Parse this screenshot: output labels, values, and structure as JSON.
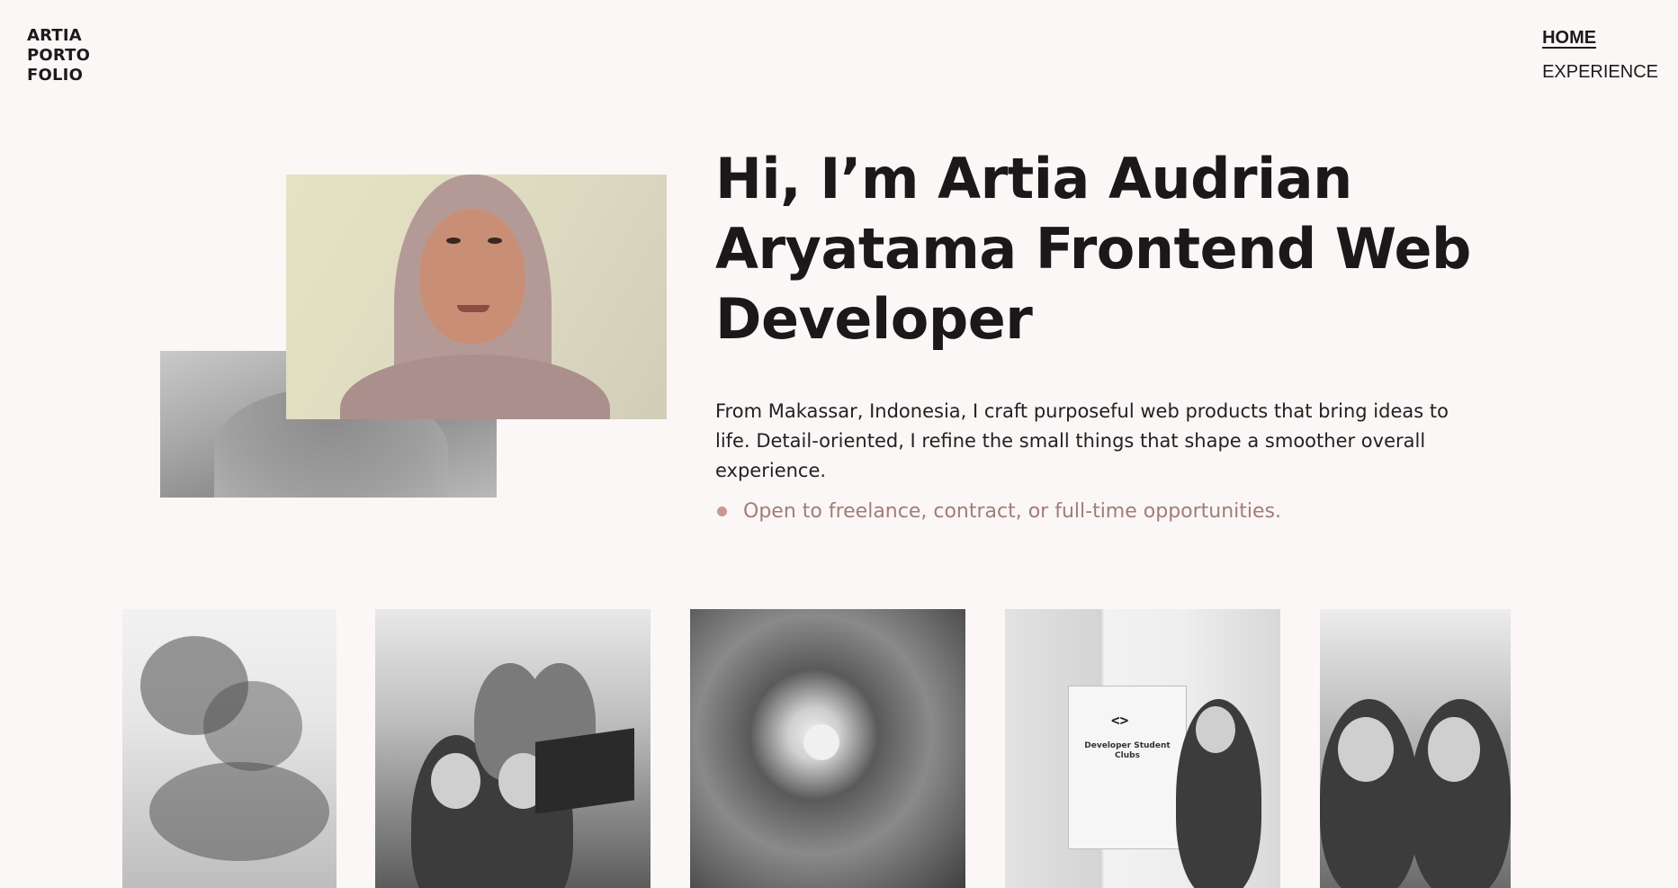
{
  "brand": {
    "logo_lines": [
      "ARTIA",
      "PORTO",
      "FOLIO"
    ]
  },
  "nav": {
    "items": [
      {
        "label": "HOME",
        "active": true
      },
      {
        "label": "EXPERIENCE",
        "active": false
      }
    ]
  },
  "hero": {
    "title": "Hi, I’m Artia Audrian Aryatama Frontend Web Developer",
    "description": "From Makassar, Indonesia, I craft purposeful web products that bring ideas to life. Detail-oriented, I refine the small things that shape a smoother overall experience.",
    "availability": "Open to freelance, contract, or full-time opportunities."
  },
  "gallery": {
    "banner_text": "Developer Student Clubs",
    "banner_logo": "<>"
  },
  "colors": {
    "background": "#fbf7f6",
    "text": "#1c1a1a",
    "accent": "#a27c7a",
    "accent_dot": "#c79995"
  }
}
